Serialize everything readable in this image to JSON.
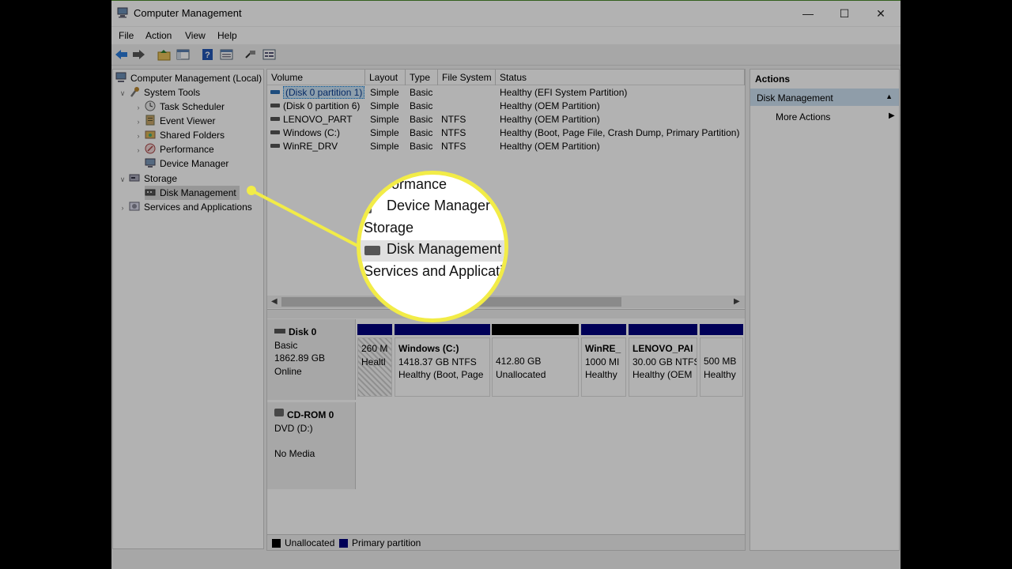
{
  "window": {
    "title": "Computer Management"
  },
  "menu": [
    "File",
    "Action",
    "View",
    "Help"
  ],
  "tree": {
    "root": "Computer Management (Local)",
    "system_tools": "System Tools",
    "task_scheduler": "Task Scheduler",
    "event_viewer": "Event Viewer",
    "shared_folders": "Shared Folders",
    "performance": "Performance",
    "device_manager": "Device Manager",
    "storage": "Storage",
    "disk_management": "Disk Management",
    "services": "Services and Applications"
  },
  "volumes": {
    "headers": [
      "Volume",
      "Layout",
      "Type",
      "File System",
      "Status"
    ],
    "rows": [
      {
        "volume": "(Disk 0 partition 1)",
        "layout": "Simple",
        "type": "Basic",
        "fs": "",
        "status": "Healthy (EFI System Partition)"
      },
      {
        "volume": "(Disk 0 partition 6)",
        "layout": "Simple",
        "type": "Basic",
        "fs": "",
        "status": "Healthy (OEM Partition)"
      },
      {
        "volume": "LENOVO_PART",
        "layout": "Simple",
        "type": "Basic",
        "fs": "NTFS",
        "status": "Healthy (OEM Partition)"
      },
      {
        "volume": "Windows (C:)",
        "layout": "Simple",
        "type": "Basic",
        "fs": "NTFS",
        "status": "Healthy (Boot, Page File, Crash Dump, Primary Partition)"
      },
      {
        "volume": "WinRE_DRV",
        "layout": "Simple",
        "type": "Basic",
        "fs": "NTFS",
        "status": "Healthy (OEM Partition)"
      }
    ]
  },
  "disk0": {
    "name": "Disk 0",
    "type": "Basic",
    "size": "1862.89 GB",
    "state": "Online",
    "partitions": [
      {
        "name": "",
        "line1": "260 M",
        "line2": "Healtl"
      },
      {
        "name": "Windows  (C:)",
        "line1": "1418.37 GB NTFS",
        "line2": "Healthy (Boot, Page"
      },
      {
        "name": "",
        "line1": "412.80 GB",
        "line2": "Unallocated"
      },
      {
        "name": "WinRE_",
        "line1": "1000 MI",
        "line2": "Healthy"
      },
      {
        "name": "LENOVO_PAI",
        "line1": "30.00 GB NTFS",
        "line2": "Healthy (OEM"
      },
      {
        "name": "",
        "line1": "500 MB",
        "line2": "Healthy"
      }
    ]
  },
  "cdrom": {
    "name": "CD-ROM 0",
    "drive": "DVD (D:)",
    "media": "No Media"
  },
  "legend": {
    "unallocated": "Unallocated",
    "primary": "Primary partition"
  },
  "actions": {
    "header": "Actions",
    "section": "Disk Management",
    "more": "More Actions"
  },
  "magnifier": {
    "line1": "erformance",
    "line2": "Device Manager",
    "line3": "Storage",
    "line4": "Disk Management",
    "line5": "Services and Applicati"
  },
  "colors": {
    "callout": "#f2ec47",
    "primary": "#00007d",
    "unallocated": "#000000"
  }
}
